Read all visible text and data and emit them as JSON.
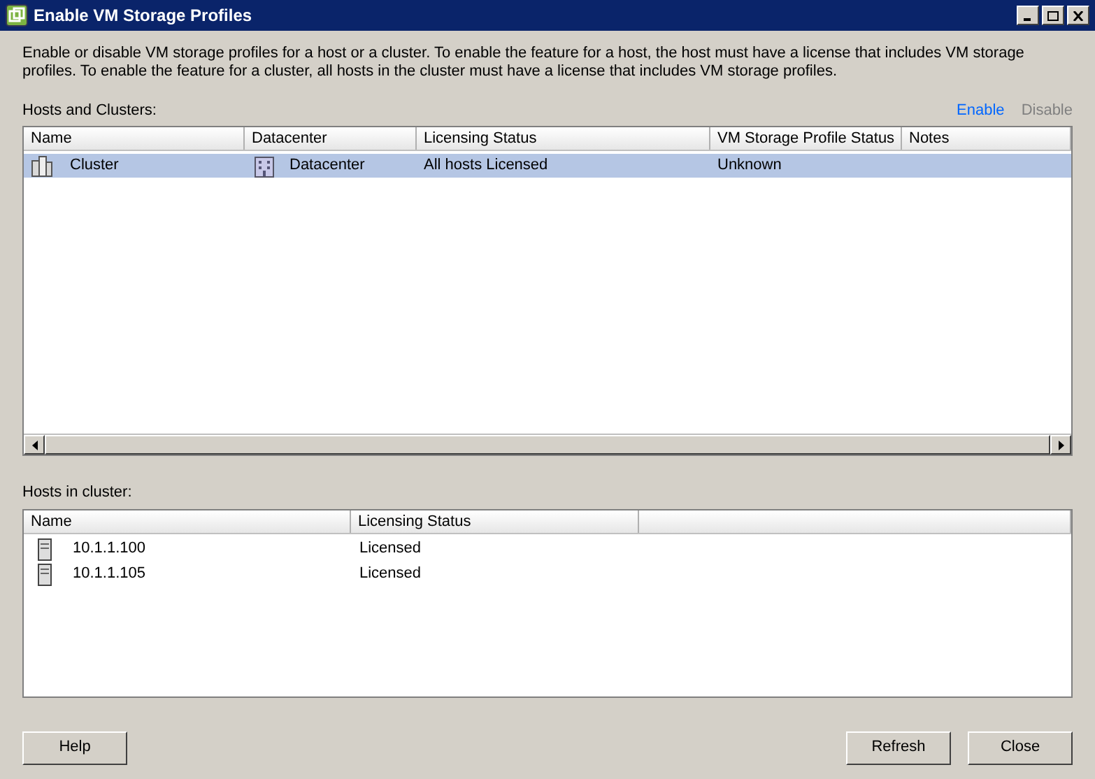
{
  "window": {
    "title": "Enable VM Storage Profiles"
  },
  "description": "Enable or disable VM storage profiles for a host or a cluster. To enable the feature for a host, the host must have a license that includes VM storage profiles. To enable the feature for a cluster, all hosts in the cluster must have a license that includes VM storage profiles.",
  "hosts_and_clusters": {
    "label": "Hosts and Clusters:",
    "actions": [
      {
        "label": "Enable",
        "disabled": false
      },
      {
        "label": "Disable",
        "disabled": true
      }
    ],
    "columns": [
      "Name",
      "Datacenter",
      "Licensing Status",
      "VM Storage Profile Status",
      "Notes"
    ],
    "rows": [
      {
        "name": "Cluster",
        "datacenter": "Datacenter",
        "licensing_status": "All hosts Licensed",
        "profile_status": "Unknown",
        "selected": true
      }
    ]
  },
  "hosts_in_cluster": {
    "label": "Hosts in cluster:",
    "columns": [
      "Name",
      "Licensing Status"
    ],
    "rows": [
      {
        "name": "10.1.1.100",
        "licensing_status": "Licensed",
        "selected": false
      },
      {
        "name": "10.1.1.105",
        "licensing_status": "Licensed",
        "selected": false
      }
    ]
  },
  "buttons": {
    "left": [
      "Help"
    ],
    "right": [
      "Refresh",
      "Close"
    ]
  }
}
